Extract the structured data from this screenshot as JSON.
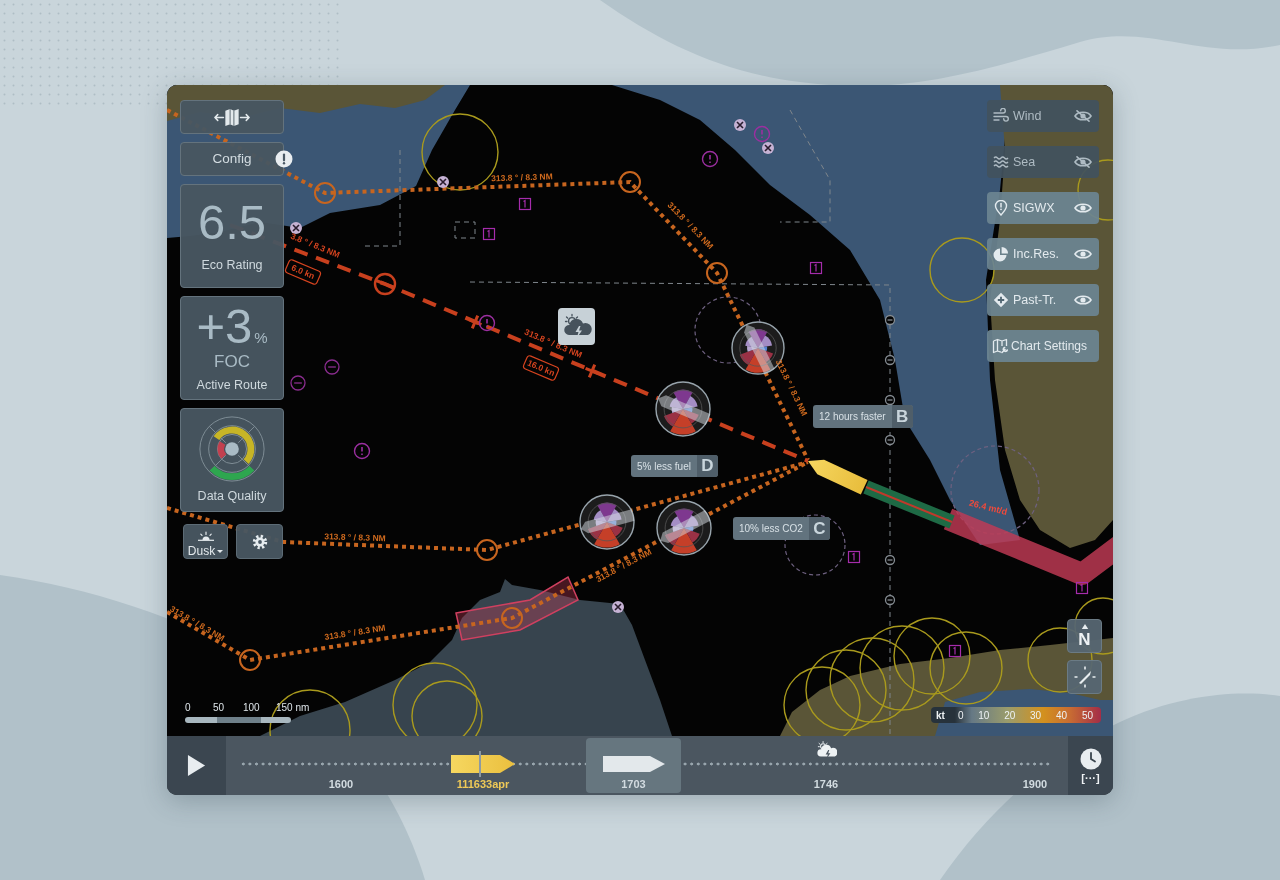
{
  "left_panel": {
    "config": {
      "label": "Config",
      "alert": true
    },
    "eco_rating": {
      "value": "6.5",
      "label": "Eco Rating"
    },
    "foc": {
      "value": "+3",
      "unit": "%",
      "label": "FOC",
      "caption": "Active Route"
    },
    "data_quality": {
      "label": "Data Quality"
    },
    "theme": {
      "label": "Dusk"
    }
  },
  "layers": [
    {
      "kind": "wind",
      "label": "Wind",
      "visible": false
    },
    {
      "kind": "sea",
      "label": "Sea",
      "visible": false
    },
    {
      "kind": "sigwx",
      "label": "SIGWX",
      "visible": true
    },
    {
      "kind": "incidents",
      "label": "Inc.Res.",
      "visible": true
    },
    {
      "kind": "past_track",
      "label": "Past-Tr.",
      "visible": true
    },
    {
      "kind": "settings",
      "label": "Chart Settings"
    }
  ],
  "map": {
    "route_labels": [
      {
        "text": "313.8 ° / 8.3 NM",
        "kind": "alternative"
      },
      {
        "text": "313.8 ° / 8.3 NM",
        "kind": "active"
      },
      {
        "text": "313.8 ° / 8.3 NM",
        "kind": "alternative"
      },
      {
        "text": "313.8 ° / 8.3 NM",
        "kind": "alternative"
      },
      {
        "text": "313.8 ° / 8.3 NM",
        "kind": "alternative"
      },
      {
        "text": "313.8 ° / 8.3 NM",
        "kind": "alternative"
      },
      {
        "text": "313.8 ° / 8.3 NM",
        "kind": "alternative"
      },
      {
        "text": "313.8 ° / 8.3 NM",
        "kind": "alternative"
      },
      {
        "text": "3.8 ° / 8.3 NM",
        "kind": "active"
      }
    ],
    "speed_tags": [
      "16.0 kn",
      "6.0 kn"
    ],
    "consumption_label": "26.4 mt/d",
    "callouts": [
      {
        "text": "12 hours faster",
        "letter": "B"
      },
      {
        "text": "5% less fuel",
        "letter": "D"
      },
      {
        "text": "10% less CO2",
        "letter": "C"
      }
    ]
  },
  "north_button": {
    "label": "N"
  },
  "scale_bar": {
    "ticks": [
      "0",
      "50",
      "100",
      "150 nm"
    ]
  },
  "wind_legend": {
    "unit": "kt",
    "ticks": [
      "0",
      "10",
      "20",
      "30",
      "40",
      "50"
    ]
  },
  "timeline": {
    "marks": [
      {
        "label": "1600",
        "kind": "time",
        "selected": false
      },
      {
        "label": "111633apr",
        "kind": "now",
        "selected": false
      },
      {
        "label": "1703",
        "kind": "time",
        "selected": true
      },
      {
        "label": "1746",
        "kind": "weather",
        "selected": false
      },
      {
        "label": "1900",
        "kind": "time",
        "selected": false
      }
    ],
    "more_label": "[···]"
  }
}
